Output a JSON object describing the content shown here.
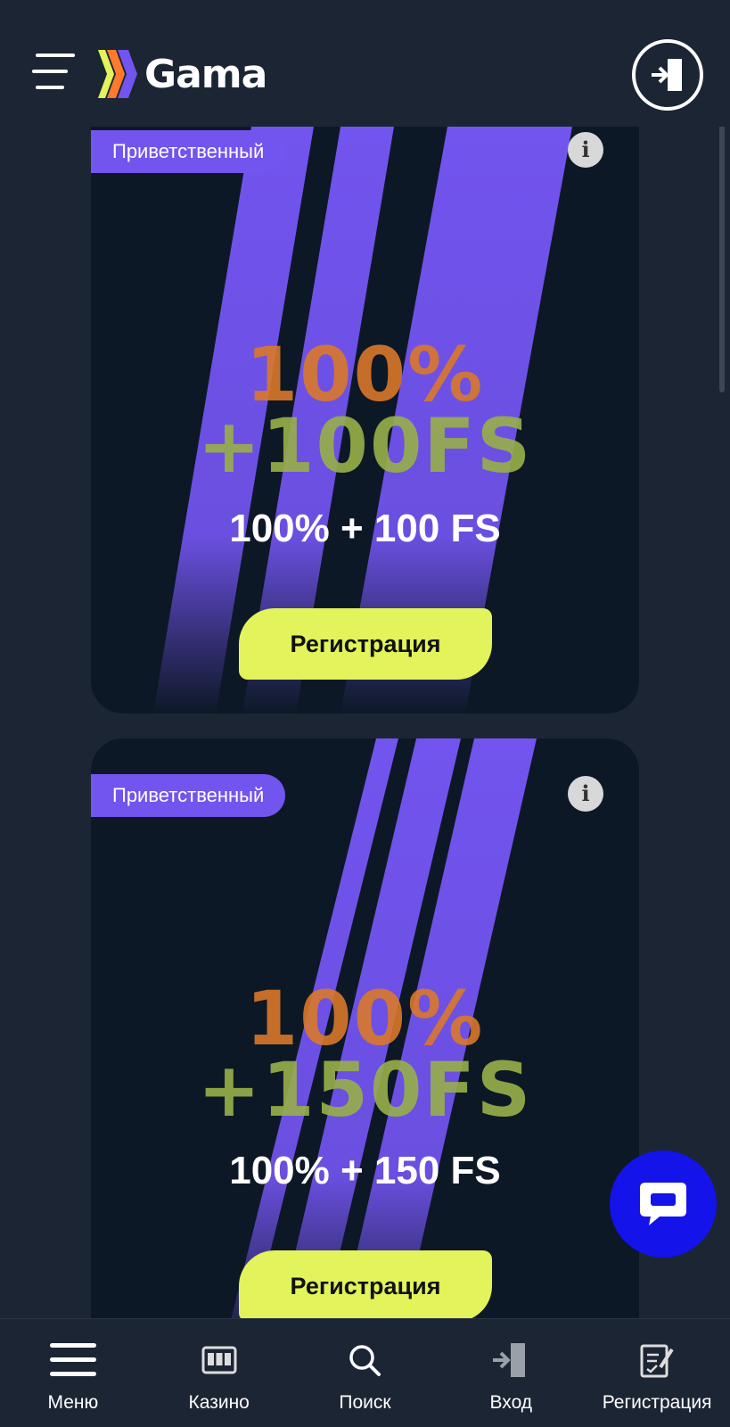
{
  "header": {
    "logo_text": "Gama",
    "menu_icon": "hamburger-icon",
    "login_icon": "login-door-icon"
  },
  "colors": {
    "background": "#1c2534",
    "card_bg": "#0d1826",
    "accent_purple": "#7254ee",
    "button_lime": "#e2f35b",
    "chat_blue": "#1313ea"
  },
  "cards": [
    {
      "badge": "Приветственный",
      "promo_line1": "100%",
      "promo_line2": "+100FS",
      "subtitle": "100% + 100 FS",
      "button": "Регистрация"
    },
    {
      "badge": "Приветственный",
      "promo_line1": "100%",
      "promo_line2": "+150FS",
      "subtitle": "100% + 150 FS",
      "button": "Регистрация"
    }
  ],
  "chat": {
    "icon": "chat-bubble-icon"
  },
  "bottom_nav": [
    {
      "label": "Меню",
      "icon": "hamburger-icon"
    },
    {
      "label": "Казино",
      "icon": "slot-machine-icon"
    },
    {
      "label": "Поиск",
      "icon": "search-icon"
    },
    {
      "label": "Вход",
      "icon": "login-door-icon"
    },
    {
      "label": "Регистрация",
      "icon": "register-clipboard-icon"
    }
  ]
}
